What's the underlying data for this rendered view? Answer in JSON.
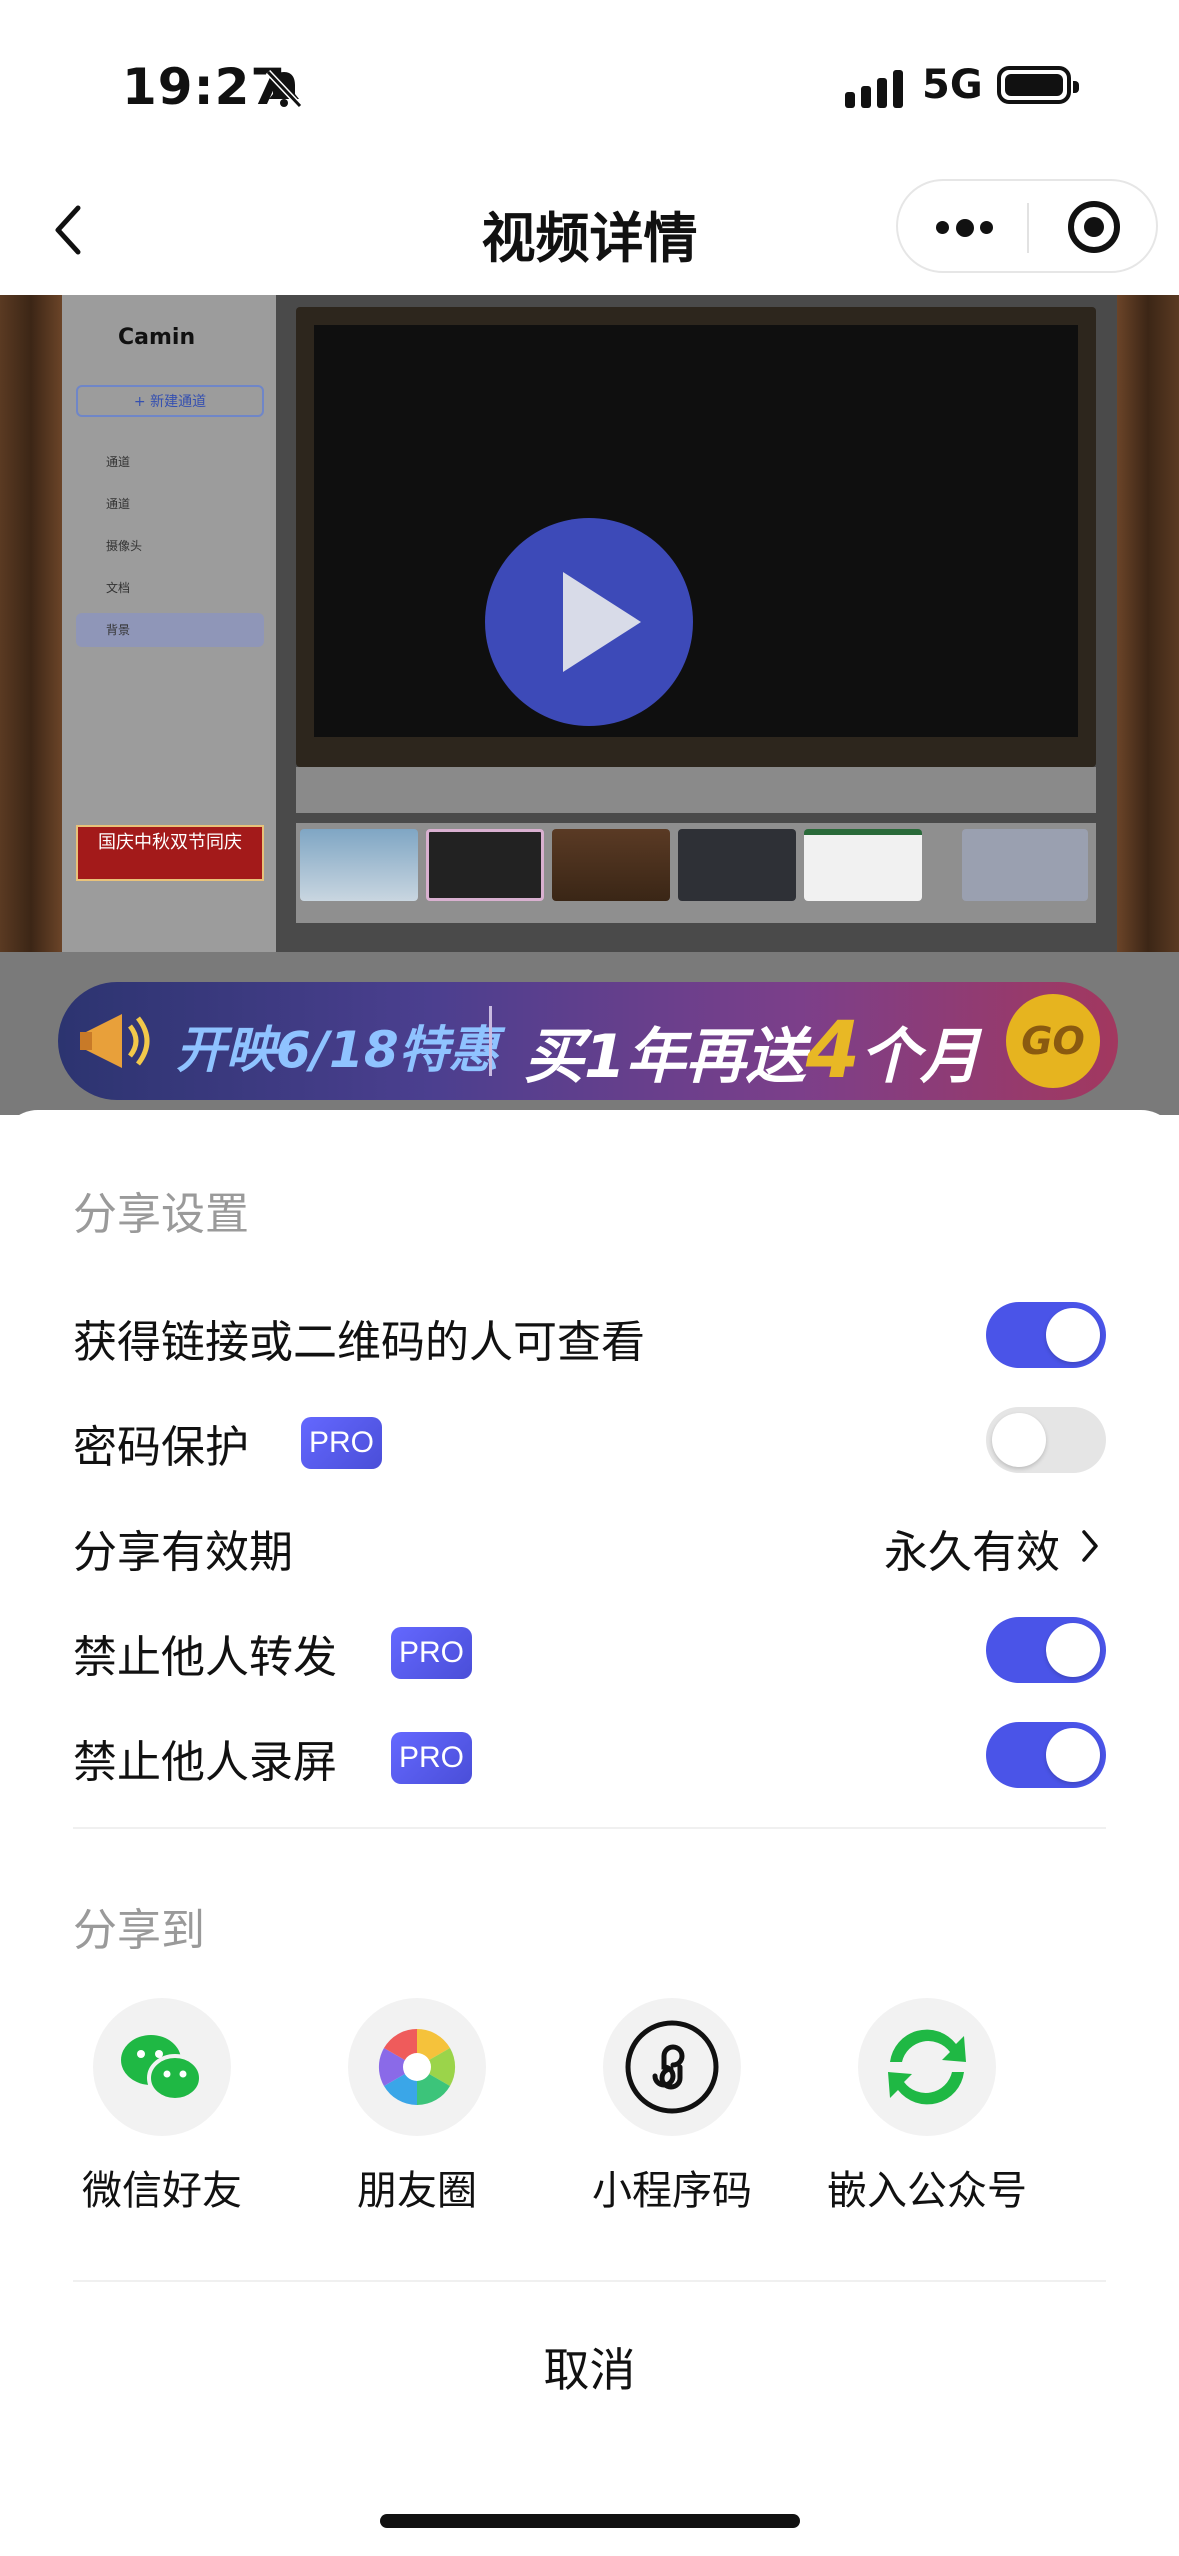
{
  "status_bar": {
    "time": "19:27",
    "network": "5G"
  },
  "nav": {
    "title": "视频详情"
  },
  "video": {
    "app_logo": "Camin",
    "app_new_button": "+ 新建通道",
    "app_items": [
      "通道",
      "通道",
      "摄像头",
      "文档",
      "背景"
    ],
    "app_banner": "国庆中秋双节同庆"
  },
  "promo": {
    "text1": "开映6/18特惠",
    "text2_pre": "买1年再送",
    "text2_num": "4",
    "text2_post": "个月",
    "go": "GO"
  },
  "share_settings": {
    "title": "分享设置",
    "link_visible": {
      "label": "获得链接或二维码的人可查看",
      "on": true
    },
    "password": {
      "label": "密码保护",
      "badge": "PRO",
      "on": false
    },
    "validity": {
      "label": "分享有效期",
      "value": "永久有效"
    },
    "no_forward": {
      "label": "禁止他人转发",
      "badge": "PRO",
      "on": true
    },
    "no_record": {
      "label": "禁止他人录屏",
      "badge": "PRO",
      "on": true
    }
  },
  "share_to": {
    "title": "分享到",
    "items": [
      {
        "label": "微信好友",
        "icon": "wechat-icon"
      },
      {
        "label": "朋友圈",
        "icon": "moments-icon"
      },
      {
        "label": "小程序码",
        "icon": "miniprogram-icon"
      },
      {
        "label": "嵌入公众号",
        "icon": "official-account-icon"
      }
    ]
  },
  "cancel_label": "取消",
  "colors": {
    "accent": "#4a54e8",
    "toggle_off": "#e5e5e5",
    "pro_badge": "#5b5ff0"
  }
}
